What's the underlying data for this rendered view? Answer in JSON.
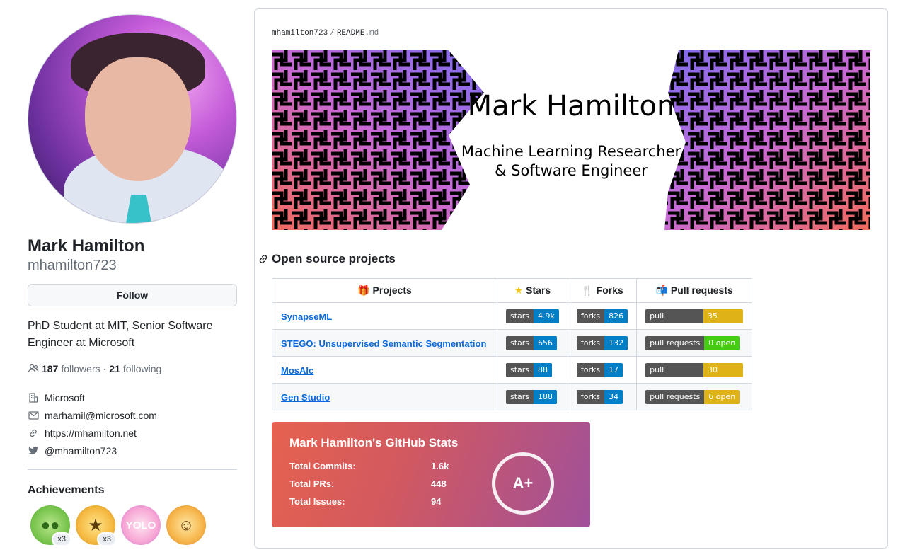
{
  "profile": {
    "name": "Mark Hamilton",
    "login": "mhamilton723",
    "follow_label": "Follow",
    "bio": "PhD Student at MIT, Senior Software Engineer at Microsoft",
    "followers_count": "187",
    "followers_label": "followers",
    "following_count": "21",
    "following_label": "following",
    "company": "Microsoft",
    "email": "marhamil@microsoft.com",
    "website": "https://mhamilton.net",
    "twitter": "@mhamilton723"
  },
  "achievements": {
    "title": "Achievements",
    "badges": [
      {
        "icon": "pair-extraordinaire-icon",
        "count": "x3"
      },
      {
        "icon": "starstruck-icon",
        "count": "x3"
      },
      {
        "icon": "yolo-icon",
        "count": ""
      },
      {
        "icon": "quickdraw-icon",
        "count": ""
      }
    ]
  },
  "readme": {
    "owner": "mhamilton723",
    "separator": "/",
    "file": "README",
    "ext": ".md",
    "banner_name": "Mark Hamilton",
    "banner_line1": "Machine Learning Researcher",
    "banner_line2": "& Software Engineer",
    "section_title": "Open source projects",
    "table": {
      "headers": [
        "Projects",
        "Stars",
        "Forks",
        "Pull requests"
      ],
      "rows": [
        {
          "name": "SynapseML",
          "stars": "4.9k",
          "forks": "826",
          "prs": "35 open",
          "pr_color": "yellow"
        },
        {
          "name": "STEGO: Unsupervised Semantic Segmentation",
          "stars": "656",
          "forks": "132",
          "prs": "0 open",
          "pr_color": "green"
        },
        {
          "name": "MosAIc",
          "stars": "88",
          "forks": "17",
          "prs": "30 open",
          "pr_color": "yellow"
        },
        {
          "name": "Gen Studio",
          "stars": "188",
          "forks": "34",
          "prs": "6 open",
          "pr_color": "yellow"
        }
      ],
      "stars_label": "stars",
      "forks_label": "forks",
      "prs_label": "pull requests"
    },
    "stats": {
      "title": "Mark Hamilton's GitHub Stats",
      "commits_label": "Total Commits:",
      "commits": "1.6k",
      "prs_label": "Total PRs:",
      "prs": "448",
      "issues_label": "Total Issues:",
      "issues": "94",
      "grade": "A+"
    }
  }
}
